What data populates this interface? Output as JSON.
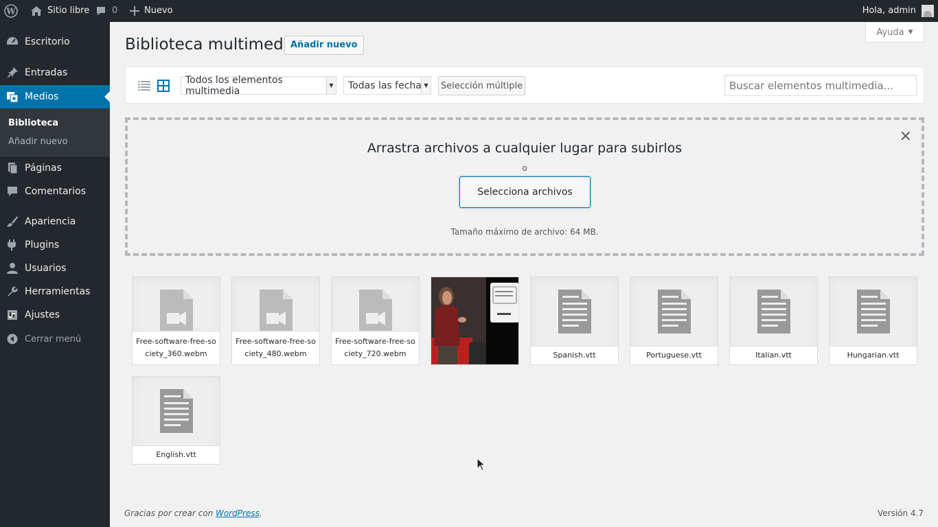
{
  "adminbar": {
    "site_name": "Sitio libre",
    "comments_count": "0",
    "new_label": "Nuevo",
    "greeting": "Hola, admin"
  },
  "sidebar": {
    "items": [
      {
        "label": "Escritorio",
        "icon": "dashboard-icon"
      },
      {
        "label": "Entradas",
        "icon": "pushpin-icon"
      },
      {
        "label": "Medios",
        "icon": "media-icon"
      },
      {
        "label": "Páginas",
        "icon": "pages-icon"
      },
      {
        "label": "Comentarios",
        "icon": "comments-icon"
      },
      {
        "label": "Apariencia",
        "icon": "brush-icon"
      },
      {
        "label": "Plugins",
        "icon": "plugin-icon"
      },
      {
        "label": "Usuarios",
        "icon": "users-icon"
      },
      {
        "label": "Herramientas",
        "icon": "wrench-icon"
      },
      {
        "label": "Ajustes",
        "icon": "settings-icon"
      }
    ],
    "submenu": [
      "Biblioteca",
      "Añadir nuevo"
    ],
    "collapse_label": "Cerrar menú"
  },
  "header": {
    "title": "Biblioteca multimedia",
    "add_new": "Añadir nuevo",
    "help": "Ayuda"
  },
  "filters": {
    "type_selected": "Todos los elementos multimedia",
    "date_selected": "Todas las fechas",
    "bulk_select": "Selección múltiple",
    "search_placeholder": "Buscar elementos multimedia..."
  },
  "uploader": {
    "title": "Arrastra archivos a cualquier lugar para subirlos",
    "or": "o",
    "button": "Selecciona archivos",
    "max_size": "Tamaño máximo de archivo: 64 MB."
  },
  "attachments": [
    {
      "type": "video",
      "name": "Free-software-free-society_360.webm"
    },
    {
      "type": "video",
      "name": "Free-software-free-society_480.webm"
    },
    {
      "type": "video",
      "name": "Free-software-free-society_720.webm"
    },
    {
      "type": "image",
      "name": ""
    },
    {
      "type": "document",
      "name": "Spanish.vtt"
    },
    {
      "type": "document",
      "name": "Portuguese.vtt"
    },
    {
      "type": "document",
      "name": "Italian.vtt"
    },
    {
      "type": "document",
      "name": "Hungarian.vtt"
    },
    {
      "type": "document",
      "name": "English.vtt"
    }
  ],
  "footer": {
    "thanks_prefix": "Gracias por crear con ",
    "thanks_link": "WordPress",
    "thanks_suffix": ".",
    "version": "Versión 4.7"
  },
  "colors": {
    "accent": "#0073aa",
    "sidebar_bg": "#23282d",
    "page_bg": "#f1f1f1"
  }
}
